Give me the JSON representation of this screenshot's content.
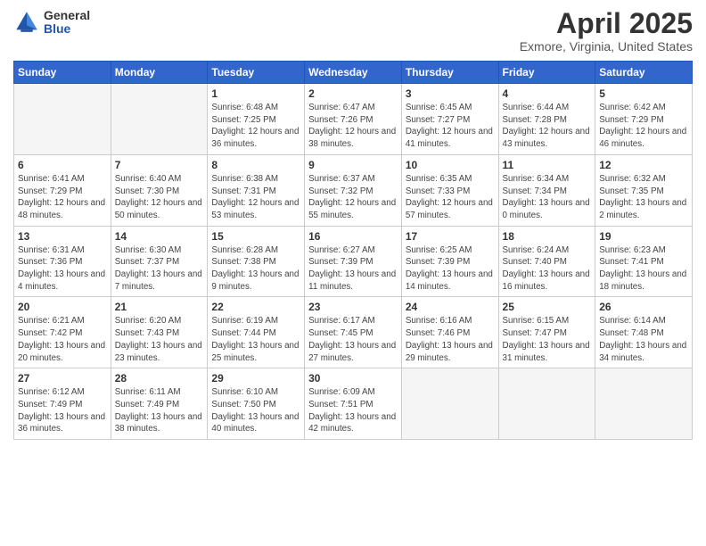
{
  "logo": {
    "general": "General",
    "blue": "Blue"
  },
  "title": "April 2025",
  "subtitle": "Exmore, Virginia, United States",
  "days_of_week": [
    "Sunday",
    "Monday",
    "Tuesday",
    "Wednesday",
    "Thursday",
    "Friday",
    "Saturday"
  ],
  "weeks": [
    [
      {
        "day": "",
        "info": ""
      },
      {
        "day": "",
        "info": ""
      },
      {
        "day": "1",
        "info": "Sunrise: 6:48 AM\nSunset: 7:25 PM\nDaylight: 12 hours and 36 minutes."
      },
      {
        "day": "2",
        "info": "Sunrise: 6:47 AM\nSunset: 7:26 PM\nDaylight: 12 hours and 38 minutes."
      },
      {
        "day": "3",
        "info": "Sunrise: 6:45 AM\nSunset: 7:27 PM\nDaylight: 12 hours and 41 minutes."
      },
      {
        "day": "4",
        "info": "Sunrise: 6:44 AM\nSunset: 7:28 PM\nDaylight: 12 hours and 43 minutes."
      },
      {
        "day": "5",
        "info": "Sunrise: 6:42 AM\nSunset: 7:29 PM\nDaylight: 12 hours and 46 minutes."
      }
    ],
    [
      {
        "day": "6",
        "info": "Sunrise: 6:41 AM\nSunset: 7:29 PM\nDaylight: 12 hours and 48 minutes."
      },
      {
        "day": "7",
        "info": "Sunrise: 6:40 AM\nSunset: 7:30 PM\nDaylight: 12 hours and 50 minutes."
      },
      {
        "day": "8",
        "info": "Sunrise: 6:38 AM\nSunset: 7:31 PM\nDaylight: 12 hours and 53 minutes."
      },
      {
        "day": "9",
        "info": "Sunrise: 6:37 AM\nSunset: 7:32 PM\nDaylight: 12 hours and 55 minutes."
      },
      {
        "day": "10",
        "info": "Sunrise: 6:35 AM\nSunset: 7:33 PM\nDaylight: 12 hours and 57 minutes."
      },
      {
        "day": "11",
        "info": "Sunrise: 6:34 AM\nSunset: 7:34 PM\nDaylight: 13 hours and 0 minutes."
      },
      {
        "day": "12",
        "info": "Sunrise: 6:32 AM\nSunset: 7:35 PM\nDaylight: 13 hours and 2 minutes."
      }
    ],
    [
      {
        "day": "13",
        "info": "Sunrise: 6:31 AM\nSunset: 7:36 PM\nDaylight: 13 hours and 4 minutes."
      },
      {
        "day": "14",
        "info": "Sunrise: 6:30 AM\nSunset: 7:37 PM\nDaylight: 13 hours and 7 minutes."
      },
      {
        "day": "15",
        "info": "Sunrise: 6:28 AM\nSunset: 7:38 PM\nDaylight: 13 hours and 9 minutes."
      },
      {
        "day": "16",
        "info": "Sunrise: 6:27 AM\nSunset: 7:39 PM\nDaylight: 13 hours and 11 minutes."
      },
      {
        "day": "17",
        "info": "Sunrise: 6:25 AM\nSunset: 7:39 PM\nDaylight: 13 hours and 14 minutes."
      },
      {
        "day": "18",
        "info": "Sunrise: 6:24 AM\nSunset: 7:40 PM\nDaylight: 13 hours and 16 minutes."
      },
      {
        "day": "19",
        "info": "Sunrise: 6:23 AM\nSunset: 7:41 PM\nDaylight: 13 hours and 18 minutes."
      }
    ],
    [
      {
        "day": "20",
        "info": "Sunrise: 6:21 AM\nSunset: 7:42 PM\nDaylight: 13 hours and 20 minutes."
      },
      {
        "day": "21",
        "info": "Sunrise: 6:20 AM\nSunset: 7:43 PM\nDaylight: 13 hours and 23 minutes."
      },
      {
        "day": "22",
        "info": "Sunrise: 6:19 AM\nSunset: 7:44 PM\nDaylight: 13 hours and 25 minutes."
      },
      {
        "day": "23",
        "info": "Sunrise: 6:17 AM\nSunset: 7:45 PM\nDaylight: 13 hours and 27 minutes."
      },
      {
        "day": "24",
        "info": "Sunrise: 6:16 AM\nSunset: 7:46 PM\nDaylight: 13 hours and 29 minutes."
      },
      {
        "day": "25",
        "info": "Sunrise: 6:15 AM\nSunset: 7:47 PM\nDaylight: 13 hours and 31 minutes."
      },
      {
        "day": "26",
        "info": "Sunrise: 6:14 AM\nSunset: 7:48 PM\nDaylight: 13 hours and 34 minutes."
      }
    ],
    [
      {
        "day": "27",
        "info": "Sunrise: 6:12 AM\nSunset: 7:49 PM\nDaylight: 13 hours and 36 minutes."
      },
      {
        "day": "28",
        "info": "Sunrise: 6:11 AM\nSunset: 7:49 PM\nDaylight: 13 hours and 38 minutes."
      },
      {
        "day": "29",
        "info": "Sunrise: 6:10 AM\nSunset: 7:50 PM\nDaylight: 13 hours and 40 minutes."
      },
      {
        "day": "30",
        "info": "Sunrise: 6:09 AM\nSunset: 7:51 PM\nDaylight: 13 hours and 42 minutes."
      },
      {
        "day": "",
        "info": ""
      },
      {
        "day": "",
        "info": ""
      },
      {
        "day": "",
        "info": ""
      }
    ]
  ]
}
